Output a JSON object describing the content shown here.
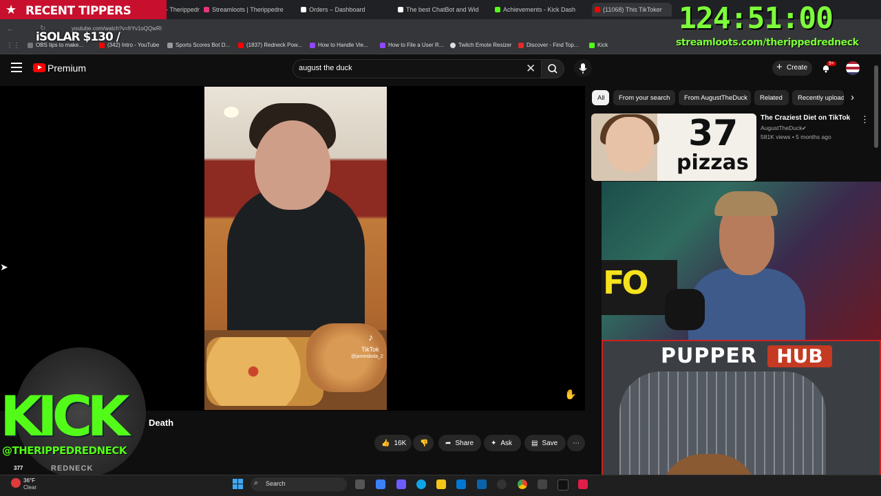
{
  "overlay": {
    "recent_tippers_title": "RECENT TIPPERS",
    "latest_tipper": "iSOLAR $130 /",
    "timer": "124:51:00",
    "timer_url": "streamloots.com/therippedredneck",
    "kick_logo": "KICK",
    "kick_handle": "@THERIPPEDREDNECK",
    "kick_sub": "REDNECK",
    "pupper_label": "PUPPER",
    "hub_label": "HUB",
    "cam_sign": "FO"
  },
  "browser": {
    "tabs": [
      {
        "label": "StreamElements - Therippedr",
        "color": "#1da1f2"
      },
      {
        "label": "Streamloots | Therippedre",
        "color": "#e8357b"
      },
      {
        "label": "Orders – Dashboard",
        "color": "#ffffff"
      },
      {
        "label": "The best ChatBot and Wid",
        "color": "#ffffff"
      },
      {
        "label": "Achievements - Kick Dash",
        "color": "#53fc18"
      },
      {
        "label": "(11068) This TikToker",
        "color": "#ff0000"
      }
    ],
    "url": "youtube.com/watch?v=frYv1oQQwRI",
    "bookmarks": [
      {
        "label": "OBS tips to make...",
        "color": "#777777"
      },
      {
        "label": "(342) Intro - YouTube",
        "color": "#ff0000"
      },
      {
        "label": "Sports Scores Bot D...",
        "color": "#999999"
      },
      {
        "label": "(1837) Redneck Pow...",
        "color": "#ff0000"
      },
      {
        "label": "How to Handle Vie...",
        "color": "#9146ff"
      },
      {
        "label": "How to File a User R...",
        "color": "#9146ff"
      },
      {
        "label": "Twitch Emote Resizer",
        "color": "#dddddd"
      },
      {
        "label": "Discover - Find Top...",
        "color": "#e22b2b"
      },
      {
        "label": "Kick",
        "color": "#53fc18"
      }
    ]
  },
  "youtube": {
    "brand": "Premium",
    "search_query": "august the duck",
    "create_label": "Create",
    "notification_count": "9+",
    "video_title": "Death",
    "views": "377",
    "actions": {
      "likes": "16K",
      "share": "Share",
      "ask": "Ask",
      "save": "Save"
    },
    "chips": [
      "All",
      "From your search",
      "From AugustTheDuck",
      "Related",
      "Recently uploaded"
    ],
    "recommended": {
      "title": "The Craziest Diet on TikTok",
      "channel": "AugustTheDuck",
      "meta": "581K views • 5 months ago",
      "thumb_big": "37",
      "thumb_small": "pizzas"
    },
    "tiktok_label": "TikTok",
    "tiktok_handle": "@jamesbola_2"
  },
  "taskbar": {
    "temp": "36°F",
    "condition": "Clear",
    "search_label": "Search"
  },
  "colors": {
    "kick_green": "#53fc18",
    "timer_green": "#7dff3a",
    "youtube_red": "#ff0000",
    "alert_red": "#c8102e"
  }
}
